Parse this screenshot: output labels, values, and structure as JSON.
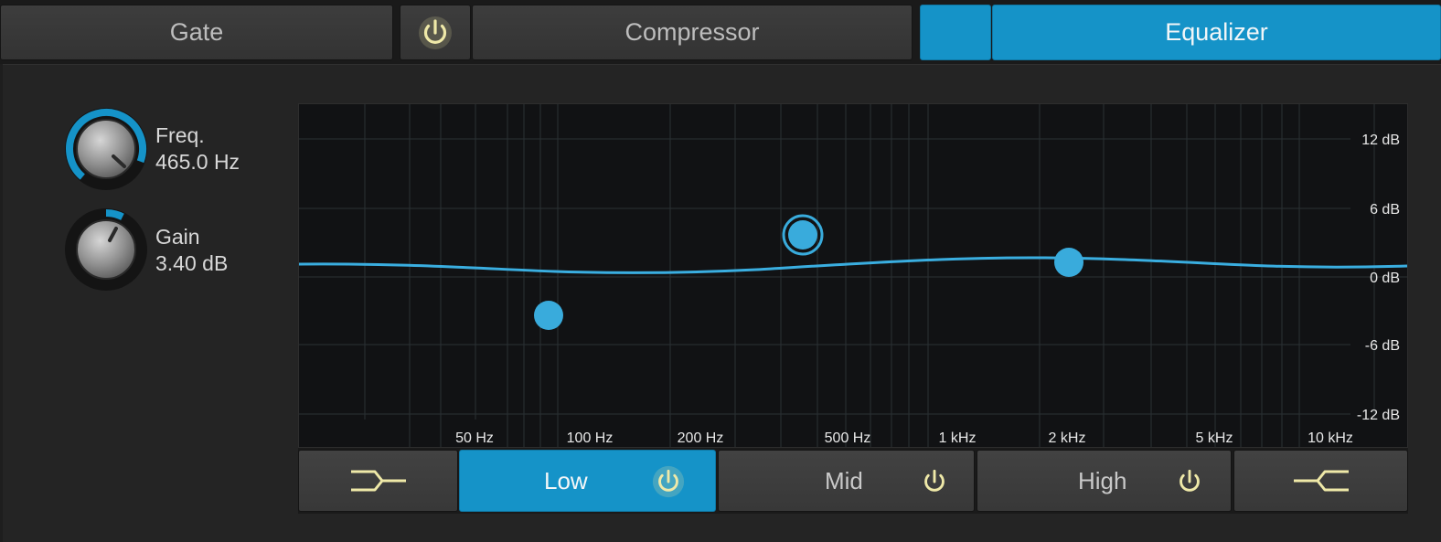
{
  "tabs": {
    "gate": "Gate",
    "compressor": "Compressor",
    "equalizer": "Equalizer"
  },
  "knobs": {
    "freq": {
      "label": "Freq.",
      "value": "465.0 Hz"
    },
    "gain": {
      "label": "Gain",
      "value": "3.40 dB"
    }
  },
  "graph": {
    "x_labels": [
      "50 Hz",
      "100 Hz",
      "200 Hz",
      "500 Hz",
      "1 kHz",
      "2 kHz",
      "5 kHz",
      "10 kHz"
    ],
    "y_labels": [
      "12 dB",
      "6 dB",
      "0 dB",
      "-6 dB",
      "-12 dB"
    ]
  },
  "bands": {
    "low": "Low",
    "mid": "Mid",
    "high": "High"
  },
  "colors": {
    "accent": "#1593c8",
    "power_icon": "#efe9a8",
    "curve": "#3aaee0"
  },
  "icons": {
    "power": "power-icon",
    "highpass": "high-pass-filter-icon",
    "lowpass": "low-pass-filter-icon"
  }
}
